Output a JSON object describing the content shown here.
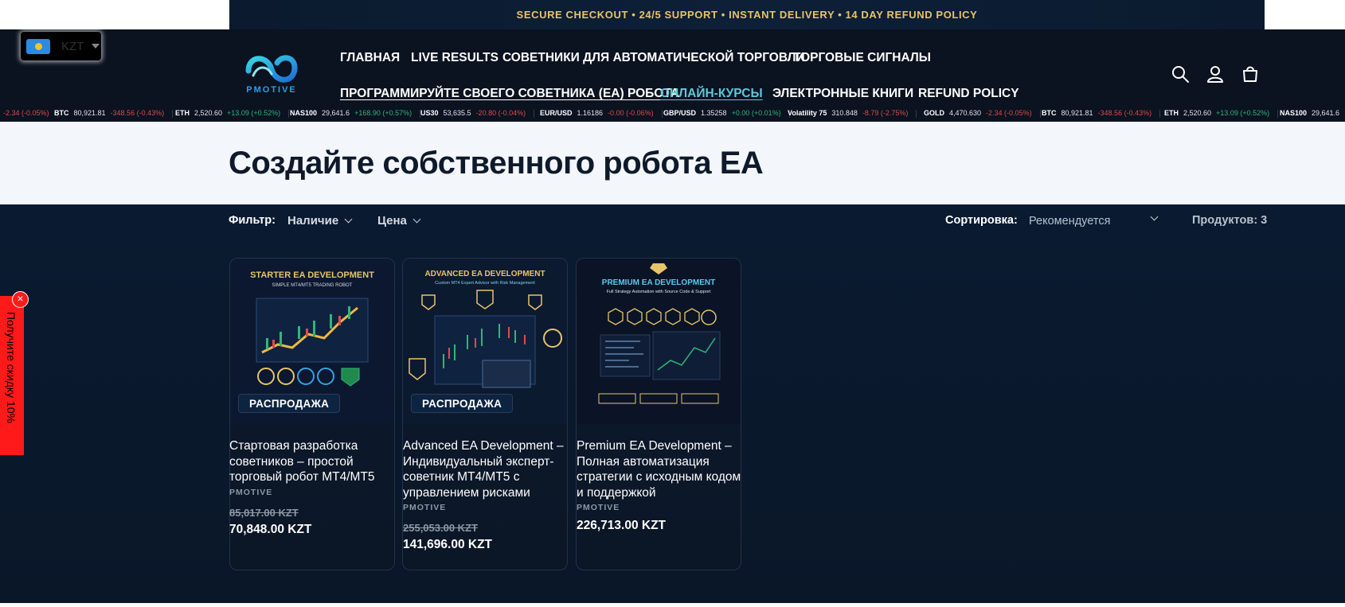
{
  "announcement": "SECURE CHECKOUT • 24/5 SUPPORT • INSTANT DELIVERY • 14 DAY REFUND POLICY",
  "currency": {
    "code": "KZT"
  },
  "brand": {
    "name": "PMOTIVE"
  },
  "nav": {
    "items": [
      "ГЛАВНАЯ",
      "LIVE RESULTS",
      "СОВЕТНИКИ ДЛЯ АВТОМАТИЧЕСКОЙ ТОРГОВЛИ",
      "ТОРГОВЫЕ СИГНАЛЫ",
      "ПРОГРАММИРУЙТЕ СВОЕГО СОВЕТНИКА (EA) РОБОТА",
      "ОНЛАЙН-КУРСЫ",
      "ЭЛЕКТРОННЫЕ КНИГИ",
      "REFUND POLICY"
    ]
  },
  "ticker": [
    {
      "sym": "",
      "price": "",
      "change": "-2.34 (-0.05%)",
      "dir": "neg"
    },
    {
      "sym": "BTC",
      "price": "80,921.81",
      "change": "-348.56 (-0.43%)",
      "dir": "neg"
    },
    {
      "sym": "ETH",
      "price": "2,520.60",
      "change": "+13.09 (+0.52%)",
      "dir": "pos"
    },
    {
      "sym": "NAS100",
      "price": "29,641.6",
      "change": "+168.90 (+0.57%)",
      "dir": "pos"
    },
    {
      "sym": "US30",
      "price": "53,635.5",
      "change": "-20.80 (-0.04%)",
      "dir": "neg"
    },
    {
      "sym": "EUR/USD",
      "price": "1.16186",
      "change": "-0.00 (-0.06%)",
      "dir": "neg"
    },
    {
      "sym": "GBP/USD",
      "price": "1.35258",
      "change": "+0.00 (+0.01%)",
      "dir": "pos"
    },
    {
      "sym": "Volatility 75",
      "price": "310.848",
      "change": "-8.79 (-2.75%)",
      "dir": "neg"
    },
    {
      "sym": "GOLD",
      "price": "4,470.630",
      "change": "-2.34 (-0.05%)",
      "dir": "neg"
    },
    {
      "sym": "BTC",
      "price": "80,921.81",
      "change": "-348.56 (-0.43%)",
      "dir": "neg"
    },
    {
      "sym": "ETH",
      "price": "2,520.60",
      "change": "+13.09 (+0.52%)",
      "dir": "pos"
    },
    {
      "sym": "NAS100",
      "price": "29,641.6",
      "change": "",
      "dir": "pos"
    }
  ],
  "page": {
    "title": "Создайте собственного робота EA"
  },
  "toolbar": {
    "filter_label": "Фильтр:",
    "availability": "Наличие",
    "price": "Цена",
    "sort_label": "Сортировка:",
    "sort_value": "Рекомендуется",
    "count": "Продуктов: 3"
  },
  "products": [
    {
      "image_title": "STARTER EA DEVELOPMENT",
      "image_subtitle": "SIMPLE MT4/MT5 TRADING ROBOT",
      "badge": "РАСПРОДАЖА",
      "title": "Стартовая разработка советников – простой торговый робот MT4/MT5",
      "vendor": "PMOTIVE",
      "old_price": "85,017.00 KZT",
      "price": "70,848.00 KZT"
    },
    {
      "image_title": "ADVANCED EA DEVELOPMENT",
      "image_subtitle": "Custom MT4 Expert Advisor with Risk Management",
      "badge": "РАСПРОДАЖА",
      "title": "Advanced EA Development – Индивидуальный эксперт-советник MT4/MT5 с управлением рисками",
      "vendor": "PMOTIVE",
      "old_price": "255,053.00 KZT",
      "price": "141,696.00 KZT"
    },
    {
      "image_title": "PREMIUM EA DEVELOPMENT",
      "image_subtitle": "Full Strategy Automation with Source Code & Support",
      "badge": "",
      "title": "Premium EA Development – Полная автоматизация стратегии с исходным кодом и поддержкой",
      "vendor": "PMOTIVE",
      "old_price": "",
      "price": "226,713.00 KZT"
    }
  ],
  "discount_tab": {
    "label": "Получите скидку 10%"
  },
  "colors": {
    "accent": "#5ec8d8",
    "gold": "#e7c46a",
    "navy": "#0a1a30",
    "promo_red": "#ff1a1a"
  }
}
